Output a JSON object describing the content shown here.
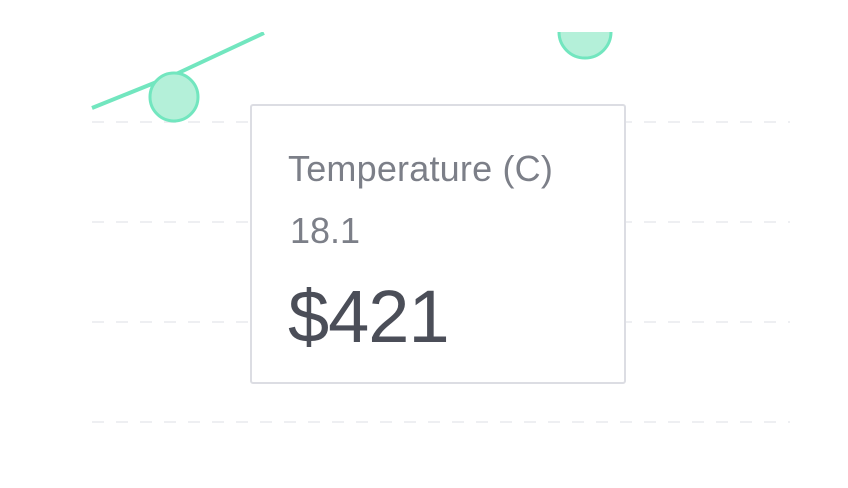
{
  "chart_data": {
    "type": "line",
    "grid": true,
    "series": [
      {
        "name": "Temperature (C)",
        "color": "#72e6bf",
        "fill": "#b4f0d9"
      }
    ],
    "tooltip": {
      "series_name": "Temperature (C)",
      "x_value": "18.1",
      "y_value": "$421"
    }
  }
}
